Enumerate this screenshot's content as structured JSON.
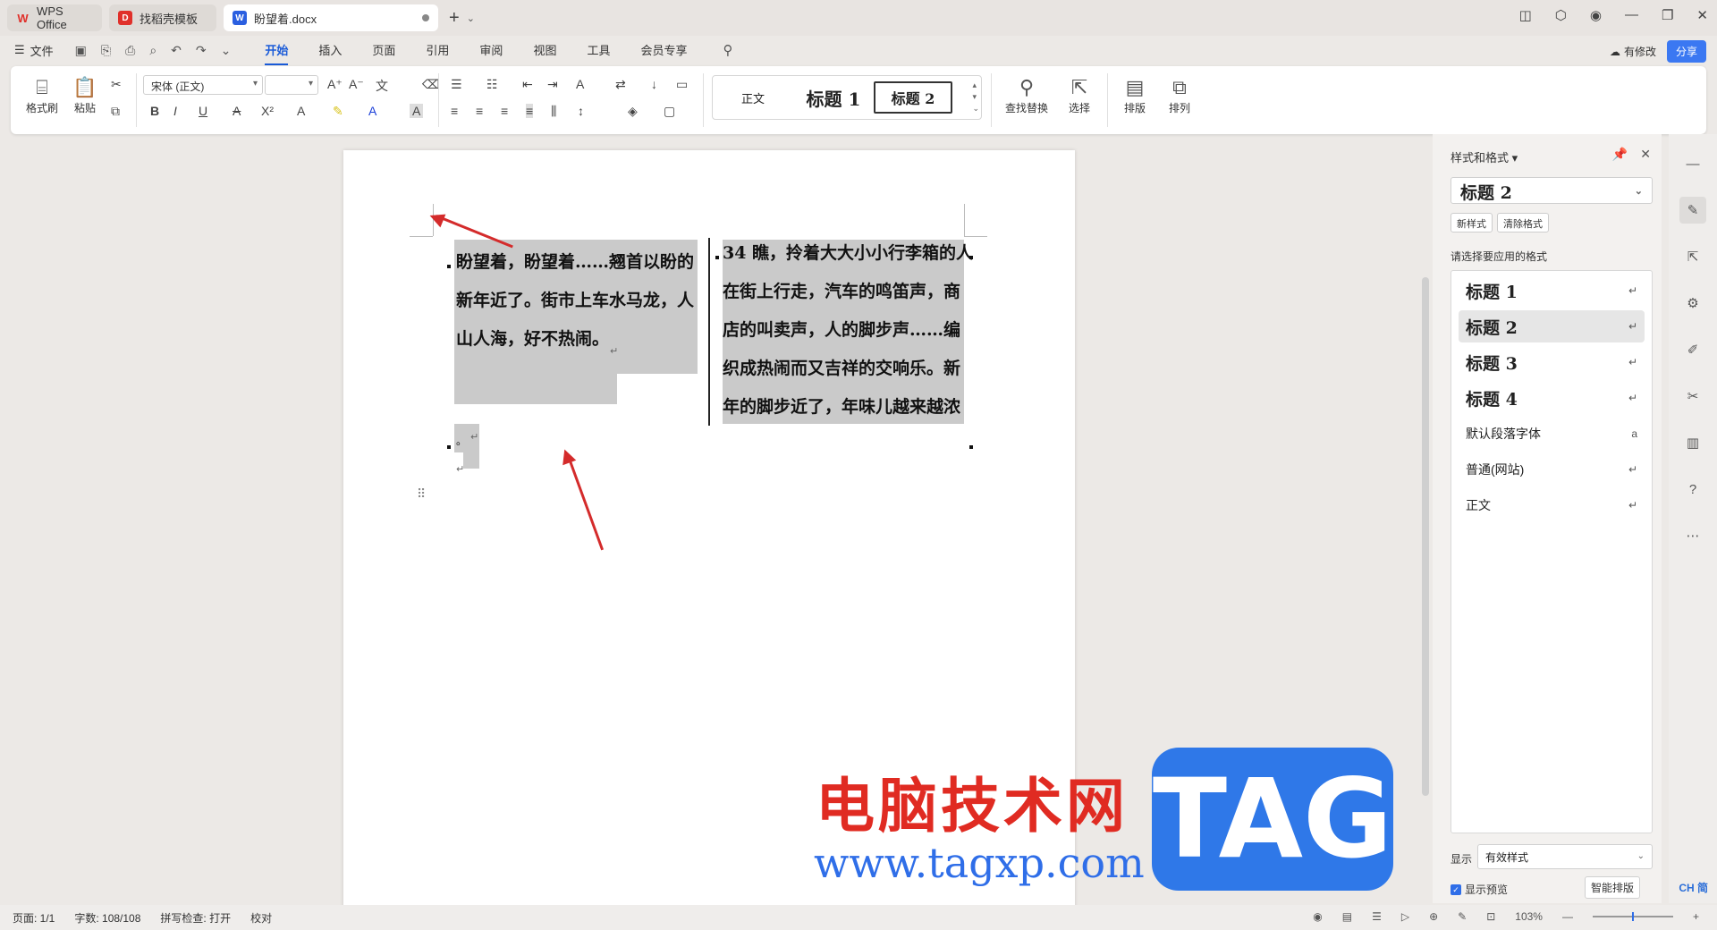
{
  "tabs": [
    {
      "label": "WPS Office"
    },
    {
      "label": "找稻壳模板"
    },
    {
      "label": "盼望着.docx"
    }
  ],
  "menubar": {
    "file": "文件",
    "tabs": [
      "开始",
      "插入",
      "页面",
      "引用",
      "审阅",
      "视图",
      "工具",
      "会员专享"
    ],
    "active_tab": "开始",
    "modified": "有修改",
    "share": "分享"
  },
  "ribbon": {
    "format_painter": "格式刷",
    "paste": "粘贴",
    "font_name": "宋体 (正文)",
    "font_size": "",
    "styles": [
      "正文",
      "标题 1",
      "标题 2"
    ],
    "find_replace": "查找替换",
    "select": "选择",
    "layout": "排版",
    "arrange": "排列"
  },
  "document": {
    "left_lines": [
      "盼望着，盼望着……翘首以盼的",
      "新年近了。街市上车水马龙，人",
      "山人海，好不热闹。"
    ],
    "right_lines": [
      "34 瞧，拎着大大小小行李箱的人",
      "在街上行走，汽车的鸣笛声，商",
      "店的叫卖声，人的脚步声……编",
      "织成热闹而又吉祥的交响乐。新",
      "年的脚步近了，年味儿越来越浓"
    ],
    "small_mark": "。"
  },
  "watermark": {
    "cn": "电脑技术网",
    "url": "www.tagxp.com",
    "tag": "TAG"
  },
  "right_panel": {
    "title": "样式和格式",
    "current_style": "标题 2",
    "new_style": "新样式",
    "clear_format": "清除格式",
    "hint": "请选择要应用的格式",
    "items": [
      "标题 1",
      "标题 2",
      "标题 3",
      "标题 4",
      "默认段落字体",
      "普通(网站)",
      "正文"
    ],
    "active_item": "标题 2",
    "show_label": "显示",
    "show_value": "有效样式",
    "preview_label": "显示预览",
    "smart_layout": "智能排版"
  },
  "statusbar": {
    "page": "页面: 1/1",
    "words": "字数: 108/108",
    "spell": "拼写检查: 打开",
    "proof": "校对",
    "zoom": "103%",
    "lang": "CH 简"
  },
  "colors": {
    "accent": "#1a5bd8",
    "share": "#3b78f2",
    "arrow": "#d42b2b",
    "highlight": "#cacaca"
  }
}
